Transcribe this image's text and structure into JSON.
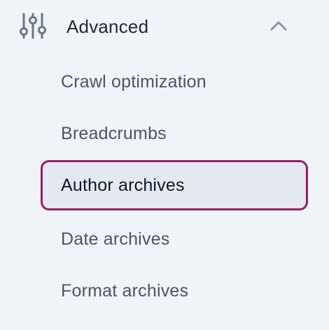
{
  "section": {
    "label": "Advanced",
    "icon": "sliders-icon",
    "toggle_icon": "chevron-up-icon",
    "expanded": true
  },
  "items": [
    {
      "label": "Crawl optimization",
      "active": false
    },
    {
      "label": "Breadcrumbs",
      "active": false
    },
    {
      "label": "Author archives",
      "active": true
    },
    {
      "label": "Date archives",
      "active": false
    },
    {
      "label": "Format archives",
      "active": false
    }
  ],
  "colors": {
    "background": "#f0f3f8",
    "active_border": "#9b1c63",
    "active_background": "#e3e8f1",
    "text": "#4b5563",
    "active_text": "#111827"
  }
}
